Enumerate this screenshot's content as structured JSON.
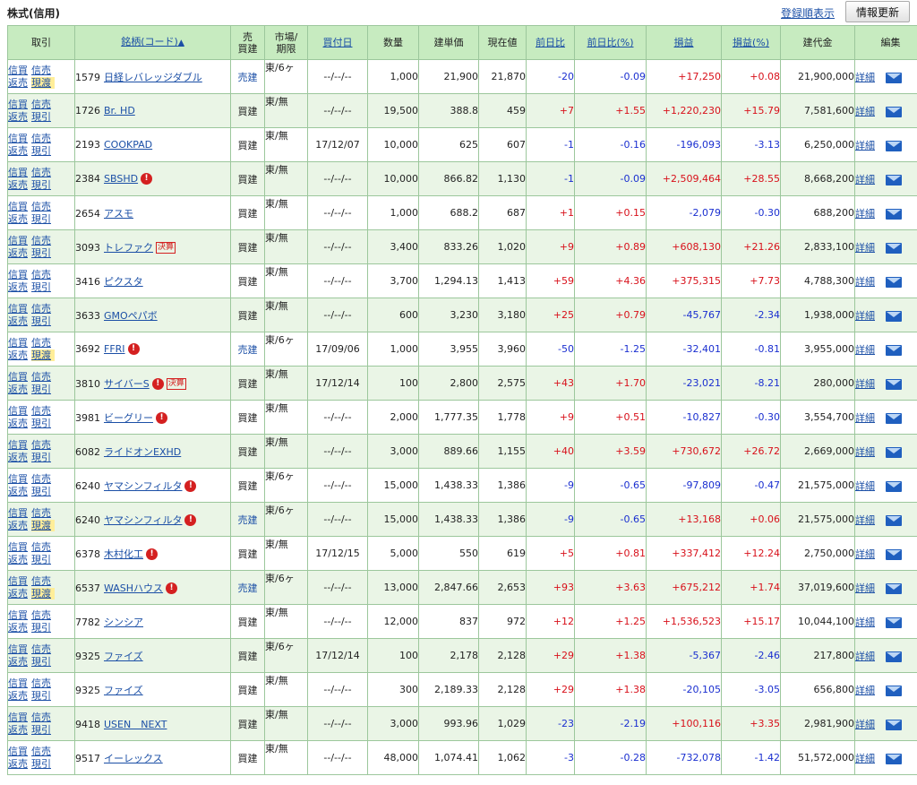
{
  "header": {
    "title": "株式(信用)",
    "register_order_link": "登録順表示",
    "refresh_button": "情報更新"
  },
  "columns": {
    "trade": "取引",
    "name": "銘柄(コード)",
    "name_sort_mark": "▲",
    "side_top": "売",
    "side_bottom": "買建",
    "market_top": "市場/",
    "market_bottom": "期限",
    "date": "買付日",
    "qty": "数量",
    "cost": "建単価",
    "price": "現在値",
    "change": "前日比",
    "change_pct": "前日比(%)",
    "pl": "損益",
    "pl_pct": "損益(%)",
    "amount": "建代金",
    "edit": "編集"
  },
  "labels": {
    "margin_buy": "信買",
    "margin_sell": "信売",
    "close_sell": "返売",
    "delivery": "現渡",
    "receipt": "現引",
    "detail": "詳細",
    "warn_glyph": "!",
    "kessan": "決算"
  },
  "colors": {
    "header_bg": "#c7ebc0",
    "row_alt_bg": "#eaf5e6",
    "positive": "#d8101a",
    "negative": "#1a2fd0",
    "link": "#1b4fa6"
  },
  "rows": [
    {
      "l2": "現渡",
      "code": "1579",
      "name": "日経レバレッジダブル",
      "warn": false,
      "kessan": false,
      "side": "売建",
      "market": "東/6ヶ",
      "date": "--/--/--",
      "qty": "1,000",
      "cost": "21,900",
      "price": "21,870",
      "change": "-20",
      "change_pct": "-0.09",
      "pl": "+17,250",
      "pl_pct": "+0.08",
      "amount": "21,900,000"
    },
    {
      "l2": "現引",
      "code": "1726",
      "name": "Br. HD",
      "warn": false,
      "kessan": false,
      "side": "買建",
      "market": "東/無",
      "date": "--/--/--",
      "qty": "19,500",
      "cost": "388.8",
      "price": "459",
      "change": "+7",
      "change_pct": "+1.55",
      "pl": "+1,220,230",
      "pl_pct": "+15.79",
      "amount": "7,581,600"
    },
    {
      "l2": "現引",
      "code": "2193",
      "name": "COOKPAD",
      "warn": false,
      "kessan": false,
      "side": "買建",
      "market": "東/無",
      "date": "17/12/07",
      "qty": "10,000",
      "cost": "625",
      "price": "607",
      "change": "-1",
      "change_pct": "-0.16",
      "pl": "-196,093",
      "pl_pct": "-3.13",
      "amount": "6,250,000"
    },
    {
      "l2": "現引",
      "code": "2384",
      "name": "SBSHD",
      "warn": true,
      "kessan": false,
      "side": "買建",
      "market": "東/無",
      "date": "--/--/--",
      "qty": "10,000",
      "cost": "866.82",
      "price": "1,130",
      "change": "-1",
      "change_pct": "-0.09",
      "pl": "+2,509,464",
      "pl_pct": "+28.55",
      "amount": "8,668,200"
    },
    {
      "l2": "現引",
      "code": "2654",
      "name": "アスモ",
      "warn": false,
      "kessan": false,
      "side": "買建",
      "market": "東/無",
      "date": "--/--/--",
      "qty": "1,000",
      "cost": "688.2",
      "price": "687",
      "change": "+1",
      "change_pct": "+0.15",
      "pl": "-2,079",
      "pl_pct": "-0.30",
      "amount": "688,200"
    },
    {
      "l2": "現引",
      "code": "3093",
      "name": "トレファク",
      "warn": false,
      "kessan": true,
      "side": "買建",
      "market": "東/無",
      "date": "--/--/--",
      "qty": "3,400",
      "cost": "833.26",
      "price": "1,020",
      "change": "+9",
      "change_pct": "+0.89",
      "pl": "+608,130",
      "pl_pct": "+21.26",
      "amount": "2,833,100"
    },
    {
      "l2": "現引",
      "code": "3416",
      "name": "ピクスタ",
      "warn": false,
      "kessan": false,
      "side": "買建",
      "market": "東/無",
      "date": "--/--/--",
      "qty": "3,700",
      "cost": "1,294.13",
      "price": "1,413",
      "change": "+59",
      "change_pct": "+4.36",
      "pl": "+375,315",
      "pl_pct": "+7.73",
      "amount": "4,788,300"
    },
    {
      "l2": "現引",
      "code": "3633",
      "name": "GMOペパボ",
      "warn": false,
      "kessan": false,
      "side": "買建",
      "market": "東/無",
      "date": "--/--/--",
      "qty": "600",
      "cost": "3,230",
      "price": "3,180",
      "change": "+25",
      "change_pct": "+0.79",
      "pl": "-45,767",
      "pl_pct": "-2.34",
      "amount": "1,938,000"
    },
    {
      "l2": "現渡",
      "code": "3692",
      "name": "FFRI",
      "warn": true,
      "kessan": false,
      "side": "売建",
      "market": "東/6ヶ",
      "date": "17/09/06",
      "qty": "1,000",
      "cost": "3,955",
      "price": "3,960",
      "change": "-50",
      "change_pct": "-1.25",
      "pl": "-32,401",
      "pl_pct": "-0.81",
      "amount": "3,955,000"
    },
    {
      "l2": "現引",
      "code": "3810",
      "name": "サイバーS",
      "warn": true,
      "kessan": true,
      "side": "買建",
      "market": "東/無",
      "date": "17/12/14",
      "qty": "100",
      "cost": "2,800",
      "price": "2,575",
      "change": "+43",
      "change_pct": "+1.70",
      "pl": "-23,021",
      "pl_pct": "-8.21",
      "amount": "280,000"
    },
    {
      "l2": "現引",
      "code": "3981",
      "name": "ビーグリー",
      "warn": true,
      "kessan": false,
      "side": "買建",
      "market": "東/無",
      "date": "--/--/--",
      "qty": "2,000",
      "cost": "1,777.35",
      "price": "1,778",
      "change": "+9",
      "change_pct": "+0.51",
      "pl": "-10,827",
      "pl_pct": "-0.30",
      "amount": "3,554,700"
    },
    {
      "l2": "現引",
      "code": "6082",
      "name": "ライドオンEXHD",
      "warn": false,
      "kessan": false,
      "side": "買建",
      "market": "東/無",
      "date": "--/--/--",
      "qty": "3,000",
      "cost": "889.66",
      "price": "1,155",
      "change": "+40",
      "change_pct": "+3.59",
      "pl": "+730,672",
      "pl_pct": "+26.72",
      "amount": "2,669,000"
    },
    {
      "l2": "現引",
      "code": "6240",
      "name": "ヤマシンフィルタ",
      "warn": true,
      "kessan": false,
      "side": "買建",
      "market": "東/6ヶ",
      "date": "--/--/--",
      "qty": "15,000",
      "cost": "1,438.33",
      "price": "1,386",
      "change": "-9",
      "change_pct": "-0.65",
      "pl": "-97,809",
      "pl_pct": "-0.47",
      "amount": "21,575,000"
    },
    {
      "l2": "現渡",
      "code": "6240",
      "name": "ヤマシンフィルタ",
      "warn": true,
      "kessan": false,
      "side": "売建",
      "market": "東/6ヶ",
      "date": "--/--/--",
      "qty": "15,000",
      "cost": "1,438.33",
      "price": "1,386",
      "change": "-9",
      "change_pct": "-0.65",
      "pl": "+13,168",
      "pl_pct": "+0.06",
      "amount": "21,575,000"
    },
    {
      "l2": "現引",
      "code": "6378",
      "name": "木村化工",
      "warn": true,
      "kessan": false,
      "side": "買建",
      "market": "東/無",
      "date": "17/12/15",
      "qty": "5,000",
      "cost": "550",
      "price": "619",
      "change": "+5",
      "change_pct": "+0.81",
      "pl": "+337,412",
      "pl_pct": "+12.24",
      "amount": "2,750,000"
    },
    {
      "l2": "現渡",
      "code": "6537",
      "name": "WASHハウス",
      "warn": true,
      "kessan": false,
      "side": "売建",
      "market": "東/6ヶ",
      "date": "--/--/--",
      "qty": "13,000",
      "cost": "2,847.66",
      "price": "2,653",
      "change": "+93",
      "change_pct": "+3.63",
      "pl": "+675,212",
      "pl_pct": "+1.74",
      "amount": "37,019,600"
    },
    {
      "l2": "現引",
      "code": "7782",
      "name": "シンシア",
      "warn": false,
      "kessan": false,
      "side": "買建",
      "market": "東/無",
      "date": "--/--/--",
      "qty": "12,000",
      "cost": "837",
      "price": "972",
      "change": "+12",
      "change_pct": "+1.25",
      "pl": "+1,536,523",
      "pl_pct": "+15.17",
      "amount": "10,044,100"
    },
    {
      "l2": "現引",
      "code": "9325",
      "name": "ファイズ",
      "warn": false,
      "kessan": false,
      "side": "買建",
      "market": "東/6ヶ",
      "date": "17/12/14",
      "qty": "100",
      "cost": "2,178",
      "price": "2,128",
      "change": "+29",
      "change_pct": "+1.38",
      "pl": "-5,367",
      "pl_pct": "-2.46",
      "amount": "217,800"
    },
    {
      "l2": "現引",
      "code": "9325",
      "name": "ファイズ",
      "warn": false,
      "kessan": false,
      "side": "買建",
      "market": "東/無",
      "date": "--/--/--",
      "qty": "300",
      "cost": "2,189.33",
      "price": "2,128",
      "change": "+29",
      "change_pct": "+1.38",
      "pl": "-20,105",
      "pl_pct": "-3.05",
      "amount": "656,800"
    },
    {
      "l2": "現引",
      "code": "9418",
      "name": "USEN　NEXT",
      "warn": false,
      "kessan": false,
      "side": "買建",
      "market": "東/無",
      "date": "--/--/--",
      "qty": "3,000",
      "cost": "993.96",
      "price": "1,029",
      "change": "-23",
      "change_pct": "-2.19",
      "pl": "+100,116",
      "pl_pct": "+3.35",
      "amount": "2,981,900"
    },
    {
      "l2": "現引",
      "code": "9517",
      "name": "イーレックス",
      "warn": false,
      "kessan": false,
      "side": "買建",
      "market": "東/無",
      "date": "--/--/--",
      "qty": "48,000",
      "cost": "1,074.41",
      "price": "1,062",
      "change": "-3",
      "change_pct": "-0.28",
      "pl": "-732,078",
      "pl_pct": "-1.42",
      "amount": "51,572,000"
    }
  ]
}
